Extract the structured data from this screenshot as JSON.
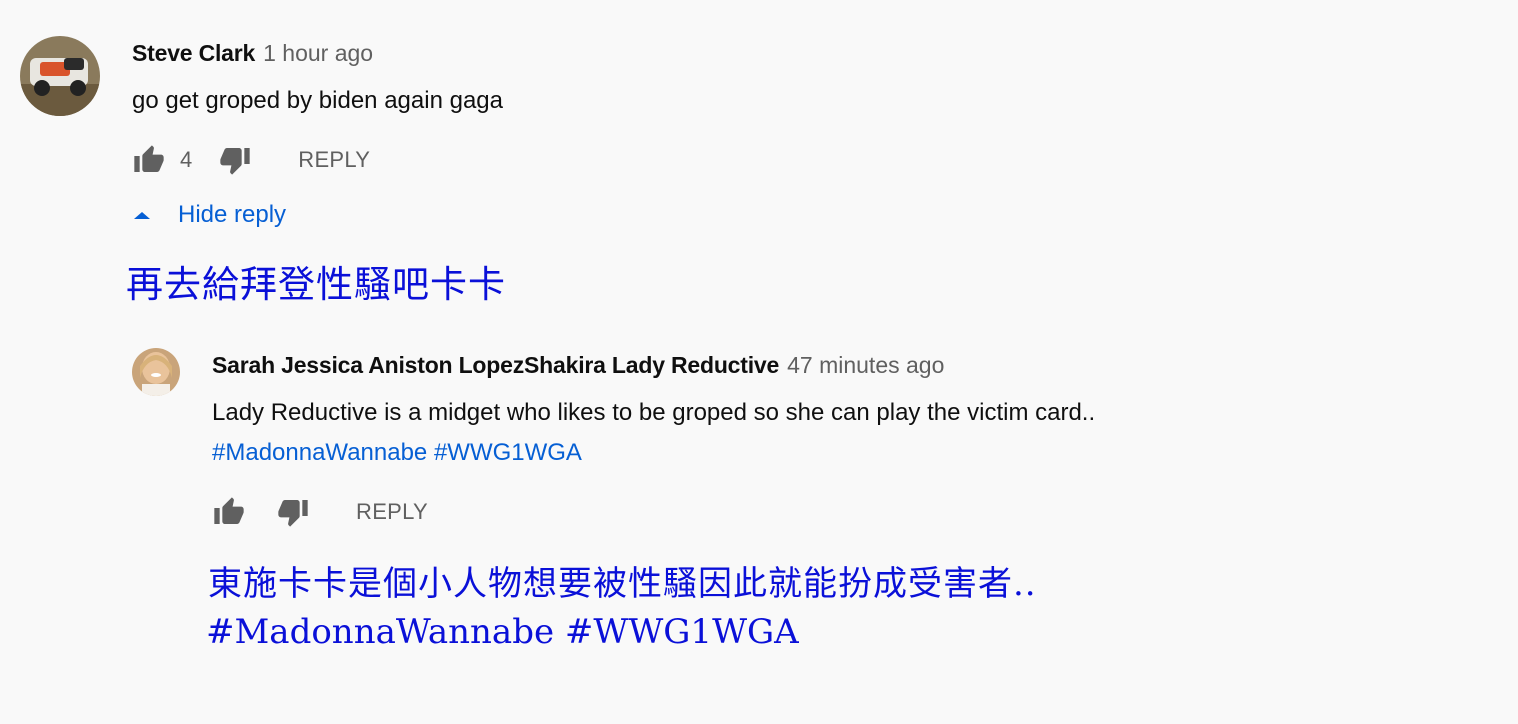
{
  "comment": {
    "author": "Steve Clark",
    "time": "1 hour ago",
    "text": "go get groped by biden again gaga",
    "like_count": "4",
    "reply_label": "REPLY",
    "avatar_icon": "truck-photo-avatar"
  },
  "hide_reply": {
    "label": "Hide reply",
    "icon": "caret-up-icon"
  },
  "translation_1": "再去給拜登性騷吧卡卡",
  "reply": {
    "author": "Sarah Jessica Aniston LopezShakira Lady Reductive",
    "time": "47 minutes ago",
    "text": "Lady Reductive is a midget who likes to be groped so she can play the victim card..",
    "hashtags": "#MadonnaWannabe #WWG1WGA",
    "reply_label": "REPLY",
    "avatar_icon": "woman-photo-avatar"
  },
  "translation_2": {
    "line1": "東施卡卡是個小人物想要被性騷因此就能扮成受害者..",
    "line2": "#MadonnaWannabe #WWG1WGA"
  },
  "colors": {
    "background": "#f9f9f9",
    "link_blue": "#065fd4",
    "secondary_text": "#606060",
    "translation_blue": "#0a10d8"
  }
}
